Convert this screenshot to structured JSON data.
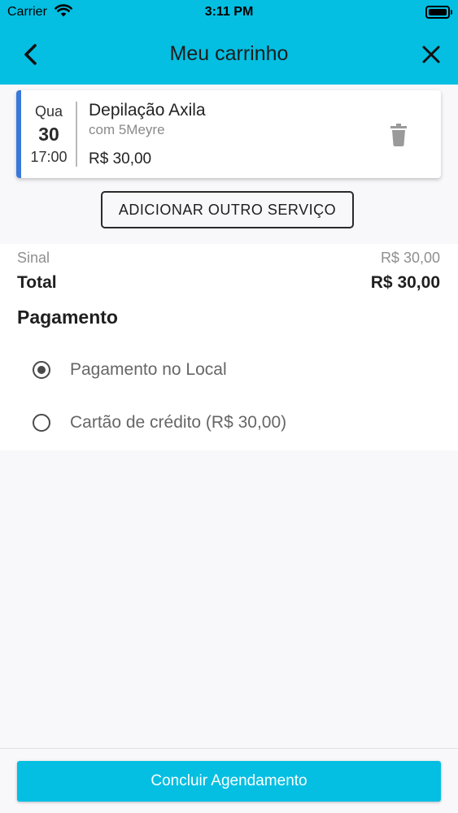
{
  "status_bar": {
    "carrier": "Carrier",
    "time": "3:11 PM"
  },
  "header": {
    "title": "Meu carrinho",
    "back_icon": "chevron-left-icon",
    "close_icon": "close-icon"
  },
  "booking": {
    "weekday": "Qua",
    "day": "30",
    "time": "17:00",
    "service": "Depilação Axila",
    "professional": "com 5Meyre",
    "price": "R$ 30,00",
    "delete_icon": "trash-icon"
  },
  "add_service_label": "ADICIONAR OUTRO SERVIÇO",
  "summary": {
    "deposit_label": "Sinal",
    "deposit_value": "R$ 30,00",
    "total_label": "Total",
    "total_value": "R$ 30,00"
  },
  "payment": {
    "title": "Pagamento",
    "options": [
      {
        "label": "Pagamento no Local",
        "selected": true
      },
      {
        "label": "Cartão de crédito (R$ 30,00)",
        "selected": false
      }
    ]
  },
  "confirm_label": "Concluir Agendamento",
  "colors": {
    "brand": "#04bfe2",
    "card_accent": "#3a78d9"
  }
}
